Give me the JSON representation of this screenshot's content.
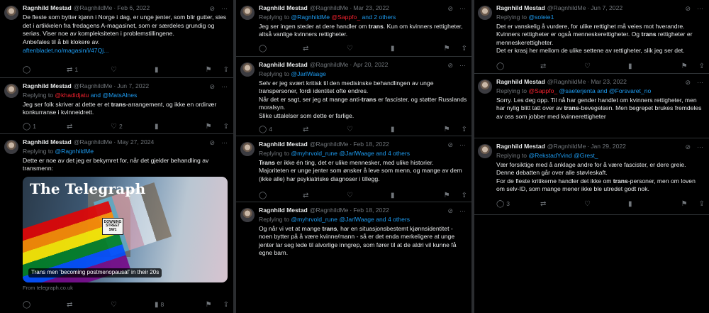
{
  "author": {
    "name": "Ragnhild Mestad",
    "handle": "@RagnhildMe"
  },
  "labels": {
    "replying_to": "Replying to",
    "and": "and"
  },
  "tweets": {
    "t1": {
      "date": "Feb 6, 2022",
      "text": "De fleste som bytter kjønn i Norge i dag, er unge jenter, som blir gutter, sies det i artikkelen fra fredagens A-magasinet, som er særdeles grundig og seriøs. Viser noe av kompleksiteten i problemstillingene.\nAnbefales til å bli klokere av.",
      "link": "aftenbladet.no/magasin/i/47Qj...",
      "replies": "",
      "retweets": "1",
      "likes": "",
      "views": ""
    },
    "t2": {
      "date": "Jun 7, 2022",
      "mention1": "@khadidjatu",
      "mention2": "@MatsAlnes",
      "text_a": "Jeg ser folk skriver at dette er et ",
      "bold": "trans",
      "text_b": "-arrangement, og ikke en ordinær konkurranse i kvinneidrett.",
      "replies": "1",
      "retweets": "",
      "likes": "2",
      "views": ""
    },
    "t3": {
      "date": "May 27, 2024",
      "mention1": "@RagnhildMe",
      "text": "Dette er noe av det jeg er bekymret for, når det gjelder behandling av transmenn:",
      "card_brand": "The Telegraph",
      "card_sign": "DOWNING STREET SW1",
      "card_caption": "Trans men 'becoming postmenopausal' in their 20s",
      "card_from": "From telegraph.co.uk",
      "replies": "",
      "retweets": "",
      "likes": "",
      "views": "8"
    },
    "t4": {
      "date": "Mar 23, 2022",
      "mention1": "@RagnhildMe",
      "mention2": "@Sappfo_",
      "mention_more": "and 2 others",
      "text_a": "Jeg ser ingen steder at dere handler om ",
      "bold": "trans",
      "text_b": ". Kun om kvinners rettigheter, altså vanlige kvinners rettigheter.",
      "replies": "",
      "retweets": "",
      "likes": "",
      "views": ""
    },
    "t5": {
      "date": "Apr 20, 2022",
      "mention1": "@JarlWaage",
      "text_a": "Selv er jeg svært kritisk til den medisinske behandlingen av unge transpersoner, fordi identitet ofte endres.\nNår det er sagt, ser jeg at mange anti-",
      "bold": "trans",
      "text_b": " er fascister, og støtter Russlands moralsyn.\nSlike uttalelser som dette er farlige.",
      "replies": "4",
      "retweets": "",
      "likes": "",
      "views": ""
    },
    "t6": {
      "date": "Feb 18, 2022",
      "mention1": "@myhrvold_rune",
      "mention2": "@JarlWaage",
      "mention_more": "and 4 others",
      "bold": "Trans",
      "text_b": " er ikke én ting, det er ulike mennesker, med ulike historier.\nMajoriteten er unge jenter som ønsker å leve som menn, og mange av dem (ikke alle) har psykiatriske diagnoser i tillegg.",
      "replies": "",
      "retweets": "",
      "likes": "",
      "views": ""
    },
    "t7": {
      "date": "Feb 18, 2022",
      "mention1": "@myhrvold_rune",
      "mention2": "@JarlWaage",
      "mention_more": "and 4 others",
      "text_a": "Og når vi vet at mange ",
      "bold": "trans",
      "text_b": ", har en situasjonsbestemt kjønnsidentitet - noen bytter på å være kvinne/mann - så er det enda merkeligere at unge jenter lar seg lede til alvorlige inngrep, som fører til at de aldri vil kunne få egne barn."
    },
    "t8": {
      "date": "Jun 7, 2022",
      "mention1": "@soleie1",
      "text_a": "Det er vanskelig å vurdere, for ulike rettighet må veies mot hverandre.\nKvinners rettigheter er også menneskerettigheter. Og ",
      "bold": "trans",
      "text_b": " rettigheter er menneskerettigheter.\nDet er krasj her mellom de ulike settene av rettigheter, slik jeg ser det.",
      "replies": "",
      "retweets": "",
      "likes": "",
      "views": ""
    },
    "t9": {
      "date": "Mar 23, 2022",
      "mention1": "@Sappfo_",
      "mention2": "@saeterjenta",
      "mention3": "@Forsvaret_no",
      "text_a": "Sorry. Les deg opp. Til nå har gender handlet om kvinners rettigheter, men har nylig blitt tatt over av ",
      "bold": "trans",
      "text_b": "-bevegelsen. Men begrepet brukes fremdeles av oss som jobber med kvinnerettigheter",
      "replies": "",
      "retweets": "",
      "likes": "",
      "views": ""
    },
    "t10": {
      "date": "Jan 29, 2022",
      "mention1": "@RekstadYvind",
      "mention2": "@Grest_",
      "text_a": "Vær forsiktige med å anklage andre for å være fascister, er dere greie.\nDenne debatten går over alle støvleskaft.\nFor de fleste kritikerne handler det ikke om ",
      "bold": "trans",
      "text_b": "-personer, men om loven om selv-ID, som mange mener ikke ble utredet godt nok.",
      "replies": "3",
      "retweets": "",
      "likes": "",
      "views": ""
    }
  },
  "colors": {
    "background": "#000000",
    "text": "#e7e9ea",
    "muted": "#71767b",
    "accent": "#1d9bf0",
    "red_mention": "#f4212e"
  },
  "icons": [
    "grok-icon",
    "more-icon",
    "reply-icon",
    "retweet-icon",
    "like-icon",
    "views-icon",
    "bookmark-icon",
    "share-icon"
  ]
}
